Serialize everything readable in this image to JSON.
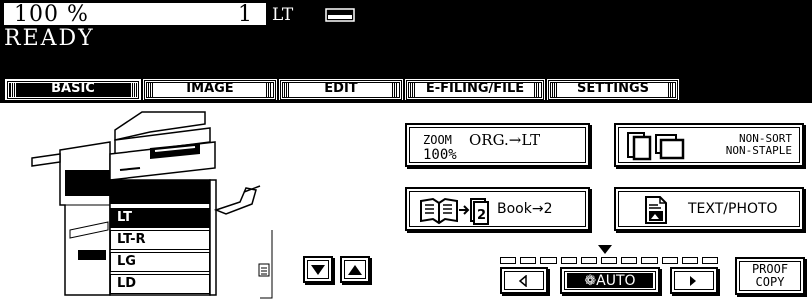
{
  "status": {
    "zoom": "100 %",
    "copies": "1",
    "paper_size": "LT",
    "tray_icon": "paper-tray-icon",
    "message": "READY"
  },
  "tabs": [
    {
      "label": "BASIC",
      "active": true
    },
    {
      "label": "IMAGE",
      "active": false
    },
    {
      "label": "EDIT",
      "active": false
    },
    {
      "label": "E-FILING/FILE",
      "active": false
    },
    {
      "label": "SETTINGS",
      "active": false
    }
  ],
  "paper_sizes": [
    "LT",
    "LT-R",
    "LG",
    "LD"
  ],
  "selected_paper": "LT",
  "zoom_button": {
    "line1_left": "ZOOM",
    "line1_right": "ORG.→LT",
    "line2": "100%"
  },
  "sort_button": {
    "line1": "NON-SORT",
    "line2": "NON-STAPLE"
  },
  "book_button": {
    "label": "Book→2",
    "icon": "book-to-two-icon"
  },
  "text_photo_button": {
    "label": "TEXT/PHOTO",
    "icon": "text-photo-icon"
  },
  "density": {
    "segments": 11,
    "selected": 5,
    "auto_label": "AUTO"
  },
  "proof_copy": {
    "line1": "PROOF",
    "line2": "COPY"
  }
}
